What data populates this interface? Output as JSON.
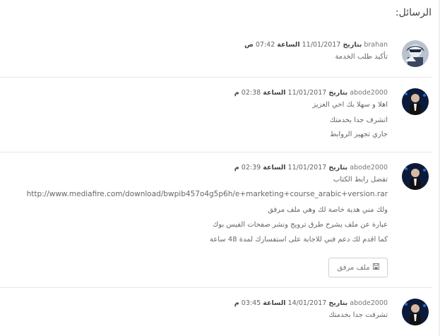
{
  "header": {
    "title": "الرسائل:"
  },
  "labels": {
    "date_word": "بتاريخ",
    "time_word": "الساعة"
  },
  "messages": [
    {
      "user": "brahan",
      "date": "11/01/2017",
      "time": "07:42",
      "ampm": "ص",
      "lines": [
        "تأكيد طلب الخدمة"
      ]
    },
    {
      "user": "abode2000",
      "date": "11/01/2017",
      "time": "02:38",
      "ampm": "م",
      "lines": [
        "اهلا و سهلا بك اخي العزيز",
        "اتشرف جدا بخدمتك",
        "جاري تجهيز الروابط"
      ]
    },
    {
      "user": "abode2000",
      "date": "11/01/2017",
      "time": "02:39",
      "ampm": "م",
      "lines": [
        "تفضل رابط الكتاب"
      ],
      "url": "http://www.mediafire.com/download/bwpib457o4g5p6h/e+marketing+course_arabic+version.rar",
      "lines_after": [
        "ولك مني هدية خاصة لك وهي ملف مرفق",
        "عبارة عن ملف يشرح طرق ترويج ونشر صفحات الفيس بوك",
        "كما اقدم لك دعم فني للاجابة على استفسارك لمدة 48 ساعة"
      ],
      "attachment_label": "ملف مرفق",
      "attachment_icon": "save-icon"
    },
    {
      "user": "abode2000",
      "date": "14/01/2017",
      "time": "03:45",
      "ampm": "م",
      "lines": [
        "تشرفت جدا بخدمتك"
      ]
    }
  ]
}
